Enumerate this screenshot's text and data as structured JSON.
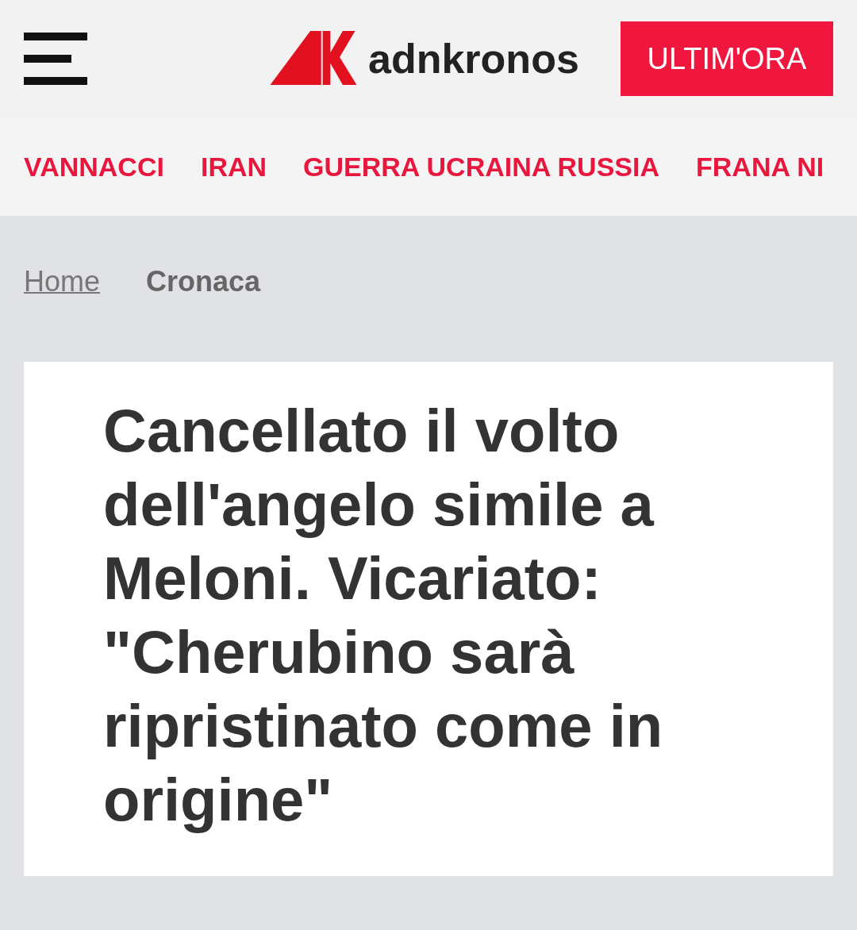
{
  "header": {
    "logo_text": "adnkronos",
    "breaking_button": "ULTIM'ORA"
  },
  "nav": [
    {
      "label": "VANNACCI"
    },
    {
      "label": "IRAN"
    },
    {
      "label": "GUERRA UCRAINA RUSSIA"
    },
    {
      "label": "FRANA NI"
    }
  ],
  "breadcrumb": [
    {
      "label": "Home",
      "kind": "link"
    },
    {
      "label": "Cronaca",
      "kind": "current"
    }
  ],
  "article": {
    "title": "Cancellato il volto dell'angelo simile a Meloni. Vicariato: \"Cherubino sarà ripristinato come in origine\""
  }
}
